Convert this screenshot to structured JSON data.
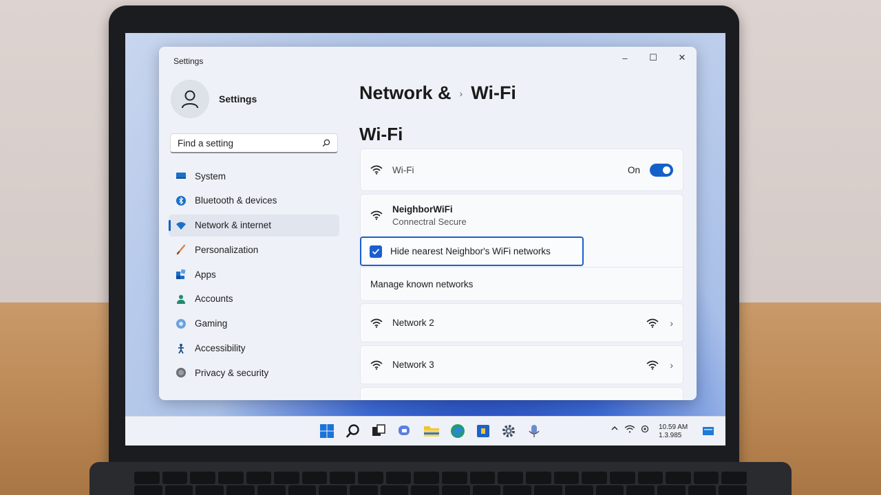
{
  "window": {
    "title": "Settings",
    "controls": {
      "minimize": "–",
      "maximize": "☐",
      "close": "✕"
    }
  },
  "profile": {
    "name": "Settings"
  },
  "search": {
    "placeholder": "Find a setting"
  },
  "sidebar": {
    "items": [
      {
        "label": "System",
        "icon": "system-icon",
        "active": false
      },
      {
        "label": "Bluetooth & devices",
        "icon": "bluetooth-icon",
        "active": false
      },
      {
        "label": "Network & internet",
        "icon": "network-icon",
        "active": true
      },
      {
        "label": "Personalization",
        "icon": "brush-icon",
        "active": false
      },
      {
        "label": "Apps",
        "icon": "apps-icon",
        "active": false
      },
      {
        "label": "Accounts",
        "icon": "accounts-icon",
        "active": false
      },
      {
        "label": "Gaming",
        "icon": "gaming-icon",
        "active": false
      },
      {
        "label": "Accessibility",
        "icon": "accessibility-icon",
        "active": false
      },
      {
        "label": "Privacy & security",
        "icon": "shield-icon",
        "active": false
      }
    ]
  },
  "breadcrumb": {
    "parent": "Network &",
    "separator": "›",
    "current": "Wi-Fi"
  },
  "main": {
    "section_title": "Wi-Fi",
    "wifi_toggle": {
      "label": "Wi-Fi",
      "state": "On"
    },
    "connected": {
      "name": "NeighborWiFi",
      "status": "Connectral Secure"
    },
    "hide_option": {
      "label": "Hide nearest Neighbor's WiFi networks",
      "checked": true
    },
    "manage_label": "Manage known networks",
    "networks": [
      {
        "name": "Network 2"
      },
      {
        "name": "Network 3"
      }
    ]
  },
  "taskbar": {
    "time": "10.59 AM",
    "date": "1.3.985"
  },
  "colors": {
    "accent": "#1360c9",
    "window_bg": "#eef1f7"
  }
}
